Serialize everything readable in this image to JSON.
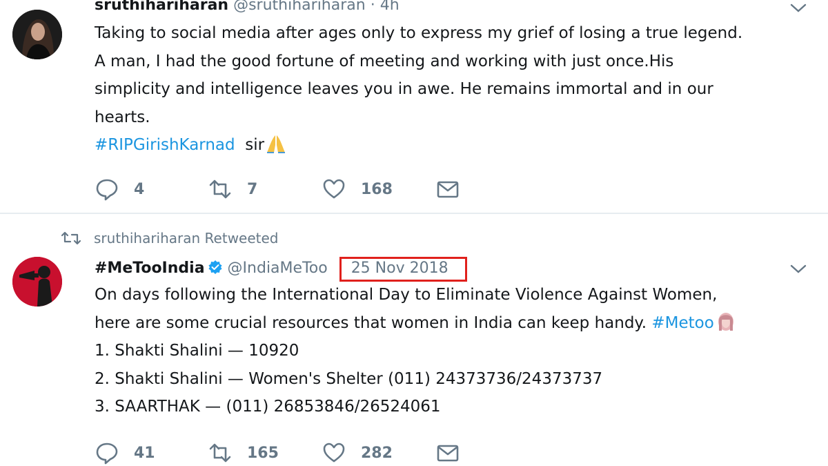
{
  "tweets": [
    {
      "display_name": "sruthihariharan",
      "handle": "@sruthihariharan",
      "separator": "·",
      "time": "4h",
      "avatar_icon": "user-avatar-photo",
      "lines": [
        "Taking to social media after ages only to express my grief of losing a true legend.",
        "A man, I had the good fortune of meeting and working with just once.His",
        "simplicity and intelligence leaves you in awe. He remains immortal and in our",
        "hearts."
      ],
      "hashtag": "#RIPGirishKarnad",
      "trailing_text": "sir",
      "trailing_emoji": "folded-hands-emoji",
      "reply_count": "4",
      "retweet_count": "7",
      "like_count": "168"
    },
    {
      "retweet_context": "sruthihariharan Retweeted",
      "display_name": "#MeTooIndia",
      "verified": true,
      "handle": "@IndiaMeToo",
      "date": "25 Nov 2018",
      "avatar_icon": "megaphone-logo",
      "lines": [
        "On days following the International Day to Eliminate Violence Against Women,",
        "here are some crucial resources that women in India can keep handy."
      ],
      "hashtag": "#Metoo",
      "trailing_emoji": "face-emoji",
      "list_items": [
        "1. Shakti Shalini — 10920",
        "2. Shakti Shalini — Women's Shelter (011) 24373736/24373737",
        "3. SAARTHAK — (011) 26853846/26524061"
      ],
      "reply_count": "41",
      "retweet_count": "165",
      "like_count": "282"
    }
  ],
  "colors": {
    "text": "#14171a",
    "secondary": "#657786",
    "link": "#1b95e0",
    "highlight_box": "#e0201c",
    "divider": "#e6ecf0"
  }
}
